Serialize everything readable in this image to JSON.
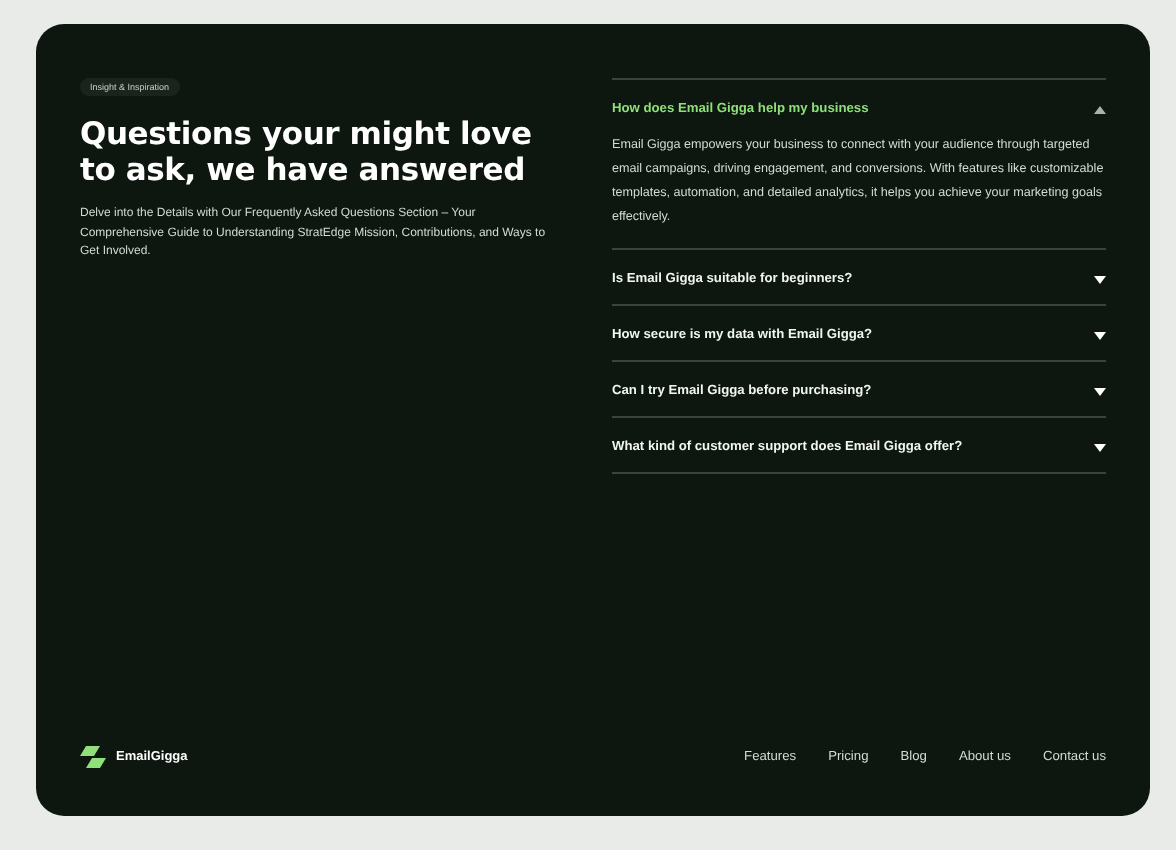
{
  "badge": "Insight & Inspiration",
  "heading": "Questions your might love to ask, we have answered",
  "intro": "Delve into the Details with Our Frequently Asked Questions Section – Your Comprehensive Guide to Understanding StratEdge Mission, Contributions, and Ways to Get Involved.",
  "faq": [
    {
      "question": "How does Email Gigga help my business",
      "expanded": true,
      "answer": "Email Gigga empowers your business to connect with your audience through targeted email campaigns, driving engagement, and conversions. With features like customizable templates, automation, and detailed analytics, it helps you achieve your marketing goals effectively."
    },
    {
      "question": "Is Email Gigga suitable for beginners?",
      "expanded": false
    },
    {
      "question": "How secure is my data with Email Gigga?",
      "expanded": false
    },
    {
      "question": "Can I try Email Gigga before purchasing?",
      "expanded": false
    },
    {
      "question": "What kind of customer support does Email Gigga offer?",
      "expanded": false
    }
  ],
  "footer": {
    "brand": "EmailGigga",
    "links": [
      "Features",
      "Pricing",
      "Blog",
      "About us",
      "Contact us"
    ]
  }
}
